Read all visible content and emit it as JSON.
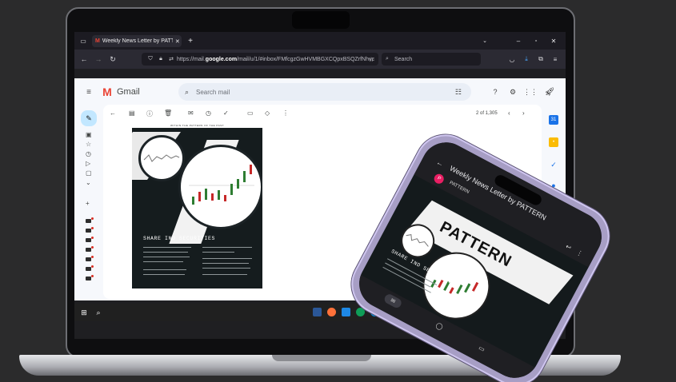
{
  "browser": {
    "tab_title": "Weekly News Letter by PATTERN",
    "new_tab": "+",
    "url_prefix": "https://mail.",
    "url_domain": "google.com",
    "url_suffix": "/mail/u/1/#inbox/FMfcgzGwHVMBGXCQpxBSQZrfNhvc",
    "search_placeholder": "Search"
  },
  "gmail": {
    "logo_text": "Gmail",
    "search_placeholder": "Search mail",
    "pager_text": "2 of 1,305"
  },
  "newsletter": {
    "top_caption": "WITHIN THE PATTERN OF THE PAST",
    "heading": "SHARE IND SECURITIES"
  },
  "phone": {
    "email_title": "Weekly News Letter by PATTERN",
    "sender_name": "PATTERN",
    "brand_text": "PATTERN",
    "heading": "SHARE IND SECURITIES"
  },
  "icons": {
    "compose": "pencil-icon",
    "inbox": "inbox-icon",
    "starred": "star-icon",
    "snoozed": "clock-icon",
    "sent": "send-icon",
    "drafts": "draft-icon"
  },
  "colors": {
    "gmail_red": "#ea4335",
    "browser_dark": "#1c1b22",
    "phone_purple": "#a79ec5"
  }
}
